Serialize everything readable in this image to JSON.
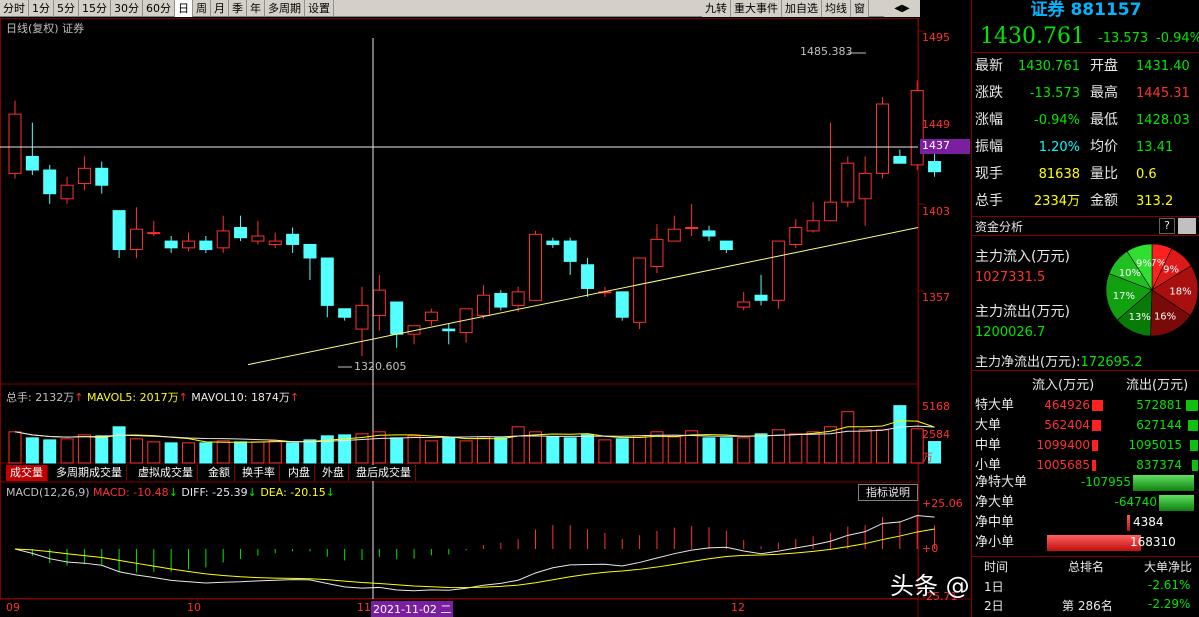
{
  "toolbar": {
    "periods": [
      "分时",
      "1分",
      "5分",
      "15分",
      "30分",
      "60分",
      "日",
      "周",
      "月",
      "季",
      "年",
      "多周期",
      "设置"
    ],
    "active_period": "日",
    "right_buttons": [
      "九转",
      "重大事件",
      "加自选",
      "均线",
      "窗"
    ]
  },
  "chart": {
    "title": "日线(复权) 证券",
    "price_axis": [
      "1495",
      "1449",
      "1437",
      "1403",
      "1357"
    ],
    "high_label": "1485.383",
    "low_label": "1320.605",
    "current_price_tag": "1437",
    "volume_stats": {
      "total_label": "总手:",
      "total_value": "2132万",
      "ma5_label": "MAVOL5:",
      "ma5_value": "2017万",
      "ma10_label": "MAVOL10:",
      "ma10_value": "1874万"
    },
    "volume_axis": [
      "5168",
      "2584",
      "万"
    ],
    "macd_stats": {
      "name": "MACD(12,26,9)",
      "macd": "MACD: -10.48",
      "diff": "DIFF: -25.39",
      "dea": "DEA: -20.15"
    },
    "macd_axis": [
      "+25.06",
      "+0",
      "-25.71"
    ],
    "indicator_button": "指标说明",
    "date_labels": [
      "09",
      "10",
      "11",
      "2021-11-02 二",
      "12"
    ],
    "watermark": "头条 @BRK逻辑投资"
  },
  "lower_tabs": [
    "成交量",
    "多周期成交量",
    "虚拟成交量",
    "金额",
    "换手率",
    "内盘",
    "外盘",
    "盘后成交量"
  ],
  "chart_data": {
    "type": "candlestick",
    "candles": [
      [
        1430,
        1465,
        1473,
        1427
      ],
      [
        1440,
        1432,
        1460,
        1429
      ],
      [
        1432,
        1418,
        1435,
        1412
      ],
      [
        1415,
        1423,
        1428,
        1412
      ],
      [
        1424,
        1433,
        1440,
        1420
      ],
      [
        1433,
        1423,
        1437,
        1418
      ],
      [
        1408,
        1385,
        1408,
        1380
      ],
      [
        1385,
        1397,
        1410,
        1380
      ],
      [
        1395,
        1395,
        1402,
        1393
      ],
      [
        1390,
        1386,
        1393,
        1383
      ],
      [
        1386,
        1390,
        1395,
        1384
      ],
      [
        1390,
        1385,
        1393,
        1383
      ],
      [
        1386,
        1396,
        1405,
        1383
      ],
      [
        1398,
        1392,
        1405,
        1390
      ],
      [
        1390,
        1393,
        1402,
        1388
      ],
      [
        1388,
        1390,
        1395,
        1386
      ],
      [
        1394,
        1388,
        1398,
        1383
      ],
      [
        1388,
        1380,
        1388,
        1367
      ],
      [
        1380,
        1352,
        1380,
        1345
      ],
      [
        1350,
        1345,
        1350,
        1343
      ],
      [
        1338,
        1352,
        1363,
        1322
      ],
      [
        1346,
        1361,
        1370,
        1337
      ],
      [
        1354,
        1335,
        1354,
        1327
      ],
      [
        1335,
        1340,
        1340,
        1329
      ],
      [
        1343,
        1348,
        1350,
        1340
      ],
      [
        1338,
        1337,
        1341,
        1329
      ],
      [
        1336,
        1350,
        1350,
        1330
      ],
      [
        1346,
        1358,
        1364,
        1344
      ],
      [
        1359,
        1351,
        1361,
        1349
      ],
      [
        1352,
        1360,
        1363,
        1348
      ],
      [
        1355,
        1394,
        1396,
        1355
      ],
      [
        1390,
        1388,
        1392,
        1386
      ],
      [
        1390,
        1378,
        1392,
        1370
      ],
      [
        1376,
        1362,
        1380,
        1357
      ],
      [
        1360,
        1360,
        1363,
        1357
      ],
      [
        1360,
        1345,
        1360,
        1343
      ],
      [
        1342,
        1380,
        1380,
        1338
      ],
      [
        1375,
        1391,
        1400,
        1371
      ],
      [
        1390,
        1397,
        1405,
        1390
      ],
      [
        1398,
        1398,
        1412,
        1393
      ],
      [
        1396,
        1393,
        1399,
        1390
      ],
      [
        1390,
        1385,
        1390,
        1383
      ],
      [
        1351,
        1354,
        1360,
        1349
      ],
      [
        1358,
        1355,
        1370,
        1352
      ],
      [
        1355,
        1390,
        1390,
        1350
      ],
      [
        1388,
        1398,
        1403,
        1386
      ],
      [
        1396,
        1402,
        1413,
        1395
      ],
      [
        1402,
        1413,
        1460,
        1402
      ],
      [
        1413,
        1436,
        1440,
        1410
      ],
      [
        1415,
        1430,
        1440,
        1399
      ],
      [
        1430,
        1471,
        1475,
        1427
      ],
      [
        1440,
        1436,
        1444,
        1436
      ],
      [
        1435,
        1479,
        1485,
        1432
      ],
      [
        1437,
        1431,
        1445,
        1428
      ]
    ],
    "volumes": [
      3100,
      2500,
      2300,
      2400,
      2800,
      2700,
      3600,
      2400,
      2100,
      2000,
      2000,
      2000,
      2200,
      2100,
      2100,
      2200,
      2000,
      2300,
      2700,
      2800,
      2900,
      3100,
      2500,
      2700,
      2200,
      2500,
      2200,
      2600,
      2500,
      3600,
      3100,
      2600,
      2500,
      2800,
      2300,
      2400,
      2700,
      3100,
      2600,
      3200,
      2500,
      2500,
      2500,
      2900,
      3300,
      2900,
      3100,
      3600,
      5100,
      3300,
      3300,
      5700,
      3400,
      2132
    ],
    "volume_ylim": [
      0,
      5168
    ],
    "price_ylim": [
      1315,
      1510
    ],
    "trend_line": [
      [
        1317,
        0
      ],
      [
        1398,
        53
      ]
    ]
  },
  "quote": {
    "name": "证券 881157",
    "price": "1430.761",
    "change": "-13.573",
    "pct": "-0.94%",
    "rows": [
      {
        "l1": "最新",
        "v1": "1430.761",
        "l2": "开盘",
        "v2": "1431.40",
        "c1": "green",
        "c2": "green"
      },
      {
        "l1": "涨跌",
        "v1": "-13.573",
        "l2": "最高",
        "v2": "1445.31",
        "c1": "green",
        "c2": "red"
      },
      {
        "l1": "涨幅",
        "v1": "-0.94%",
        "l2": "最低",
        "v2": "1428.03",
        "c1": "green",
        "c2": "green"
      },
      {
        "l1": "振幅",
        "v1": "1.20%",
        "l2": "均价",
        "v2": "13.41",
        "c1": "cyan",
        "c2": "green"
      },
      {
        "l1": "现手",
        "v1": "81638",
        "l2": "量比",
        "v2": "0.6",
        "c1": "yellow",
        "c2": "yellow"
      },
      {
        "l1": "总手",
        "v1": "2334万",
        "l2": "金额",
        "v2": "313.2",
        "c1": "yellow",
        "c2": "yellow"
      }
    ]
  },
  "fund": {
    "title": "资金分析",
    "help": "?",
    "inflow_label": "主力流入(万元)",
    "inflow_value": "1027331.5",
    "outflow_label": "主力流出(万元)",
    "outflow_value": "1200026.7",
    "net_label": "主力净流出(万元):",
    "net_value": "172695.2",
    "pie": [
      {
        "pct": "7%",
        "value": 7,
        "color": "#ff2020"
      },
      {
        "pct": "9%",
        "value": 9,
        "color": "#dd1a1a"
      },
      {
        "pct": "18%",
        "value": 18,
        "color": "#a81010"
      },
      {
        "pct": "16%",
        "value": 16,
        "color": "#7a0a0a"
      },
      {
        "pct": "13%",
        "value": 13,
        "color": "#087a08"
      },
      {
        "pct": "17%",
        "value": 17,
        "color": "#10a010"
      },
      {
        "pct": "10%",
        "value": 10,
        "color": "#20c020"
      },
      {
        "pct": "9%",
        "value": 9,
        "color": "#30e030"
      }
    ]
  },
  "flow": {
    "header_in": "流入(万元)",
    "header_out": "流出(万元)",
    "rows": [
      {
        "label": "特大单",
        "in": "464926",
        "out": "572881"
      },
      {
        "label": "大单",
        "in": "562404",
        "out": "627144"
      },
      {
        "label": "中单",
        "in": "1099400",
        "out": "1095015"
      },
      {
        "label": "小单",
        "in": "1005685",
        "out": "837374"
      }
    ],
    "net_rows": [
      {
        "label": "净特大单",
        "value": "-107955",
        "bar": 0.55,
        "color": "green"
      },
      {
        "label": "净大单",
        "value": "-64740",
        "bar": 0.32,
        "color": "green"
      },
      {
        "label": "净中单",
        "value": "4384",
        "bar": 0.02,
        "color": "red"
      },
      {
        "label": "净小单",
        "value": "168310",
        "bar": 0.85,
        "color": "red"
      }
    ],
    "bottom_headers": [
      "时间",
      "总排名",
      "大单净比"
    ],
    "bottom_rows": [
      {
        "a": "1日",
        "b": "",
        "c": "-2.61%"
      },
      {
        "a": "2日",
        "b": "第 286名",
        "c": "-2.29%"
      }
    ]
  }
}
